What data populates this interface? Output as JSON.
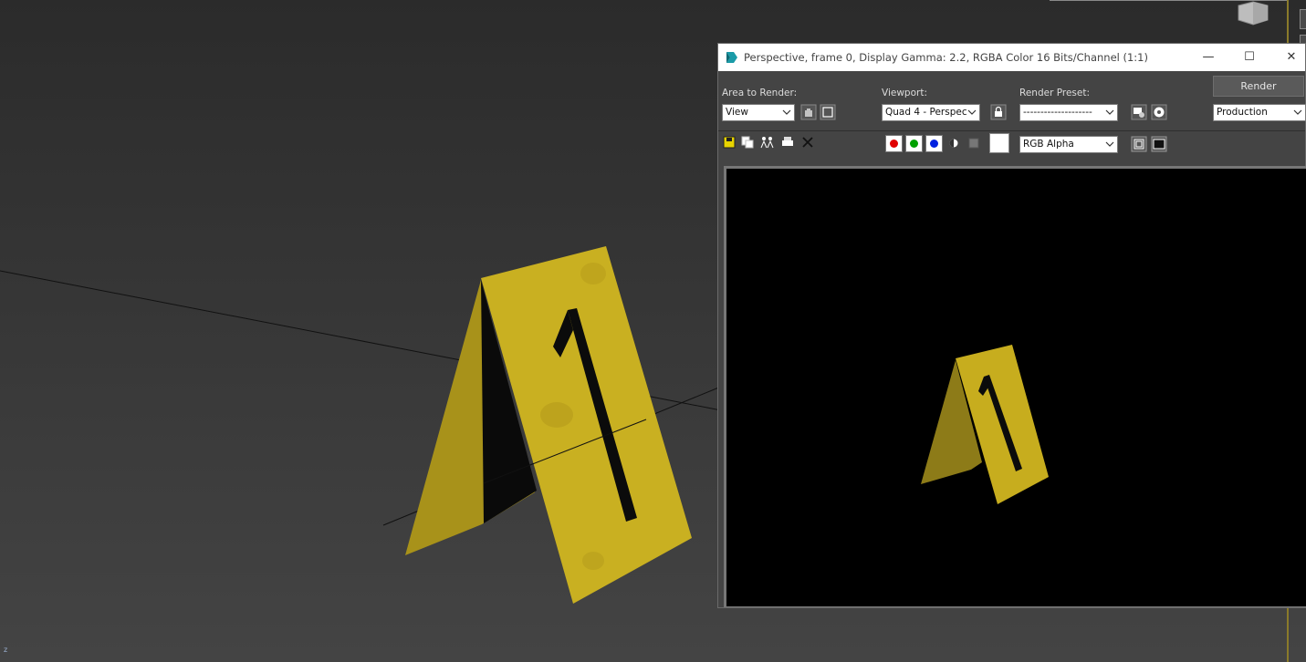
{
  "viewport": {
    "axis_label": "z",
    "background": "#333333",
    "marker_color": "#c8b020",
    "marker_number": "1"
  },
  "frame_window": {
    "title": "Perspective, frame 0, Display Gamma: 2.2, RGBA Color 16 Bits/Channel (1:1)",
    "minimize_glyph": "—",
    "maximize_glyph": "☐",
    "close_glyph": "✕",
    "area_to_render": {
      "label": "Area to Render:",
      "value": "View"
    },
    "viewport": {
      "label": "Viewport:",
      "value": "Quad 4 - Perspec"
    },
    "render_preset": {
      "label": "Render Preset:",
      "value": "--------------------"
    },
    "render_button": "Render",
    "production": {
      "value": "Production"
    },
    "channel": {
      "value": "RGB Alpha"
    },
    "channel_colors": {
      "red": "#e00000",
      "green": "#00a000",
      "blue": "#0020e0"
    },
    "render_background": "#000000"
  }
}
